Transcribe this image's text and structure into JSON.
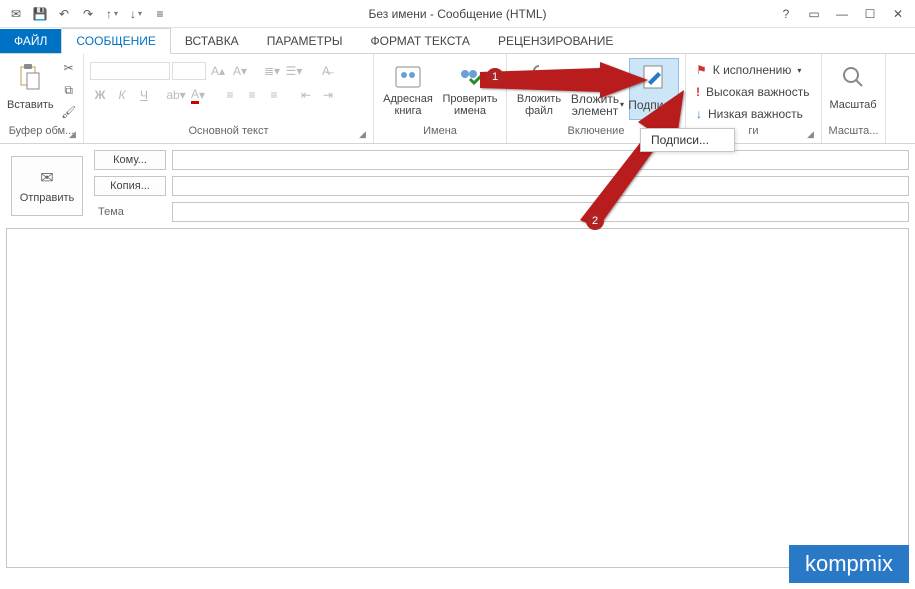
{
  "title": "Без имени - Сообщение (HTML)",
  "tabs": {
    "file": "ФАЙЛ",
    "message": "СООБЩЕНИЕ",
    "insert": "ВСТАВКА",
    "options": "ПАРАМЕТРЫ",
    "format": "ФОРМАТ ТЕКСТА",
    "review": "РЕЦЕНЗИРОВАНИЕ"
  },
  "ribbon": {
    "clipboard": {
      "paste": "Вставить",
      "label": "Буфер обм..."
    },
    "font": {
      "label": "Основной текст",
      "b": "Ж",
      "i": "К",
      "u": "Ч"
    },
    "names": {
      "addressbook": "Адресная книга",
      "checknames": "Проверить имена",
      "label": "Имена"
    },
    "include": {
      "attachfile": "Вложить файл",
      "attachitem": "Вложить элемент",
      "signature": "Подпись",
      "label": "Включение"
    },
    "tags": {
      "followup": "К исполнению",
      "high": "Высокая важность",
      "low": "Низкая важность",
      "label": "ги"
    },
    "zoom": {
      "zoom": "Масштаб",
      "label": "Масшта..."
    }
  },
  "dropdown": {
    "signatures": "Подписи..."
  },
  "compose": {
    "send": "Отправить",
    "to": "Кому...",
    "cc": "Копия...",
    "subject": "Тема"
  },
  "badges": {
    "one": "1",
    "two": "2"
  },
  "watermark": "kompmix"
}
